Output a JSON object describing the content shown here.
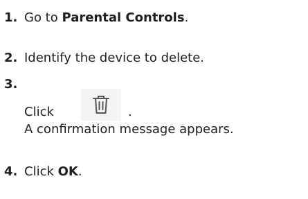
{
  "steps": [
    {
      "number": "1.",
      "prefix": "Go to ",
      "bold": "Parental Controls",
      "suffix": "."
    },
    {
      "number": "2.",
      "text": "Identify the device to delete."
    },
    {
      "number": "3.",
      "click_label": "Click",
      "icon": "trash-icon",
      "period": ".",
      "result": "A confirmation message appears."
    },
    {
      "number": "4.",
      "prefix": "Click ",
      "bold": "OK",
      "suffix": "."
    }
  ],
  "colors": {
    "text": "#1f1f1f",
    "icon_background": "#f4f4f4",
    "icon_stroke": "#555555"
  }
}
